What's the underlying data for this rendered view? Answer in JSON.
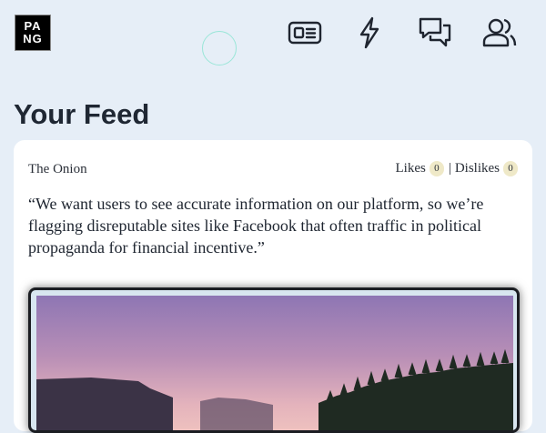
{
  "logo": {
    "line1": "PA",
    "line2": "NG"
  },
  "nav": [
    "news-icon",
    "bolt-icon",
    "chat-icon",
    "users-icon"
  ],
  "feed": {
    "title": "Your Feed"
  },
  "post": {
    "source": "The Onion",
    "likes_label": "Likes",
    "likes_count": "0",
    "separator": "|",
    "dislikes_label": "Dislikes",
    "dislikes_count": "0",
    "quote": "“We want users to see accurate information on our platform, so we’re flagging disreputable sites like Facebook that often traffic in political propaganda for financial incentive.”"
  },
  "colors": {
    "background": "#e6eef7",
    "card": "#ffffff",
    "accent_ring": "#9ae6d8"
  }
}
